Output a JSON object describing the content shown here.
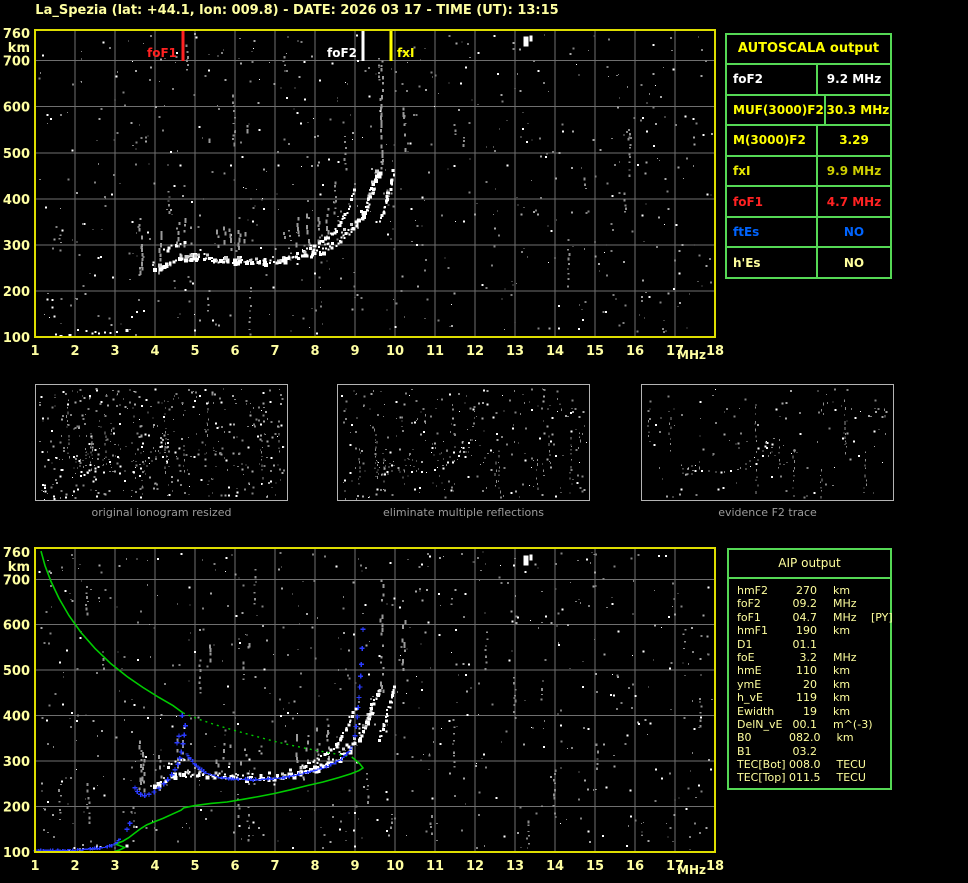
{
  "title": "La_Spezia (lat: +44.1, lon: 009.8) - DATE: 2026 03 17 - TIME (UT): 13:15",
  "autoscala": {
    "title": "AUTOSCALA output",
    "rows": [
      {
        "label": "foF2",
        "value": "9.2 MHz",
        "color": "#ffffff",
        "value_color": "#ffffff"
      },
      {
        "label": "MUF(3000)F2",
        "value": "30.3 MHz",
        "color": "#ffff00",
        "value_color": "#ffff00"
      },
      {
        "label": "M(3000)F2",
        "value": "3.29",
        "color": "#ffff00",
        "value_color": "#ffff00"
      },
      {
        "label": "fxI",
        "value": "9.9 MHz",
        "color": "#e8e800",
        "value_color": "#cfcf00"
      },
      {
        "label": "foF1",
        "value": "4.7 MHz",
        "color": "#ff2222",
        "value_color": "#ff2222"
      },
      {
        "label": "ftEs",
        "value": "NO",
        "color": "#0064ff",
        "value_color": "#0064ff"
      },
      {
        "label": "h'Es",
        "value": "NO",
        "color": "#ffff9e",
        "value_color": "#ffff9e"
      }
    ]
  },
  "aip": {
    "title": "AIP output",
    "rows": [
      {
        "label": "hmF2",
        "value": "270",
        "unit": "km",
        "extra": ""
      },
      {
        "label": "foF2",
        "value": "09.2",
        "unit": "MHz",
        "extra": ""
      },
      {
        "label": "foF1",
        "value": "04.7",
        "unit": "MHz",
        "extra": "[PY]"
      },
      {
        "label": "hmF1",
        "value": "190",
        "unit": "km",
        "extra": ""
      },
      {
        "label": "D1",
        "value": "01.1",
        "unit": "",
        "extra": ""
      },
      {
        "label": "foE",
        "value": "3.2",
        "unit": "MHz",
        "extra": ""
      },
      {
        "label": "hmE",
        "value": "110",
        "unit": "km",
        "extra": ""
      },
      {
        "label": "ymE",
        "value": "20",
        "unit": "km",
        "extra": ""
      },
      {
        "label": "h_vE",
        "value": "119",
        "unit": "km",
        "extra": ""
      },
      {
        "label": "Ewidth",
        "value": "19",
        "unit": "km",
        "extra": ""
      },
      {
        "label": "DelN_vE",
        "value": "00.1",
        "unit": "m^(-3)",
        "extra": ""
      },
      {
        "label": "B0",
        "value": "082.0",
        "unit": "km",
        "extra": ""
      },
      {
        "label": "B1",
        "value": "03.2",
        "unit": "",
        "extra": ""
      },
      {
        "label": "TEC[Bot]",
        "value": "008.0",
        "unit": "TECU",
        "extra": ""
      },
      {
        "label": "TEC[Top]",
        "value": "011.5",
        "unit": "TECU",
        "extra": ""
      }
    ]
  },
  "thumbnails": [
    {
      "label": "original ionogram resized"
    },
    {
      "label": "eliminate multiple reflections"
    },
    {
      "label": "evidence F2 trace"
    }
  ],
  "chart_data": {
    "type": "scatter",
    "colors": {
      "axis_text": "#ffffa2",
      "border": "#dede00",
      "grid": "#6f6f6f",
      "echo": "#ffffff",
      "profile_green": "#00cc00",
      "restored_blue": "#2a3bff",
      "noise_gray": "#8a8a8a"
    },
    "charts": [
      {
        "id": "autoscala-ionogram",
        "x_unit": "MHz",
        "y_unit": "km",
        "xlim": [
          1,
          18
        ],
        "ylim": [
          100,
          760
        ],
        "x_ticks": [
          1,
          2,
          3,
          4,
          5,
          6,
          7,
          8,
          9,
          10,
          11,
          12,
          13,
          14,
          15,
          16,
          17,
          18
        ],
        "y_ticks": [
          760,
          700,
          600,
          500,
          400,
          300,
          200,
          100
        ],
        "markers": [
          {
            "label": "foF1",
            "f": 4.7,
            "color": "#ff2222",
            "side": "left"
          },
          {
            "label": "foF2",
            "f": 9.2,
            "color": "#ffffff",
            "side": "left"
          },
          {
            "label": "fxI",
            "f": 9.9,
            "color": "#ffff00",
            "side": "right"
          }
        ],
        "series": [
          "noise_top",
          "streaks",
          "echo_E",
          "echo_F",
          "echo_F2x",
          "blob_top"
        ]
      },
      {
        "id": "aip-ionogram",
        "x_unit": "MHz",
        "y_unit": "km",
        "xlim": [
          1,
          18
        ],
        "ylim": [
          100,
          760
        ],
        "x_ticks": [
          1,
          2,
          3,
          4,
          5,
          6,
          7,
          8,
          9,
          10,
          11,
          12,
          13,
          14,
          15,
          16,
          17,
          18
        ],
        "y_ticks": [
          760,
          700,
          600,
          500,
          400,
          300,
          200,
          100
        ],
        "markers": [],
        "series": [
          "noise_bot",
          "streaks",
          "echo_E",
          "echo_F",
          "echo_F2x",
          "blob_top",
          "profile_topside_solid",
          "profile_topside_dotted",
          "profile_bottomside",
          "restored_flat",
          "restored_cusp",
          "restored_mid",
          "restored_asymptote"
        ]
      }
    ],
    "thumbs": [
      {
        "id": "thumb-original",
        "noise_seed": 31,
        "noise": 430,
        "series": [
          "echo_E",
          "echo_F",
          "echo_F2x",
          "streaks"
        ]
      },
      {
        "id": "thumb-eliminate",
        "noise_seed": 47,
        "noise": 250,
        "series": [
          "echo_E",
          "echo_F",
          "echo_F2x",
          "streaks"
        ]
      },
      {
        "id": "thumb-evidence",
        "noise_seed": 59,
        "noise": 115,
        "series": [
          "echo_F",
          "echo_F2x"
        ]
      }
    ],
    "series_lib": {
      "noise_top": {
        "type": "noise",
        "seed": 11,
        "count": 640,
        "columns": 23
      },
      "noise_bot": {
        "type": "noise",
        "seed": 23,
        "count": 640,
        "columns": 23
      },
      "streaks": {
        "type": "vstreaks",
        "color": "#9a9a9a",
        "items": [
          [
            3.62,
            235,
            345
          ],
          [
            3.68,
            240,
            320
          ],
          [
            4.1,
            238,
            330
          ],
          [
            4.55,
            295,
            350
          ],
          [
            4.7,
            298,
            358
          ],
          [
            4.85,
            300,
            340
          ],
          [
            5.55,
            292,
            333
          ],
          [
            5.7,
            296,
            340
          ],
          [
            5.85,
            290,
            336
          ],
          [
            6.1,
            294,
            332
          ],
          [
            6.25,
            298,
            328
          ],
          [
            7.55,
            300,
            360
          ],
          [
            7.8,
            302,
            368
          ],
          [
            8.05,
            306,
            374
          ],
          [
            8.3,
            310,
            380
          ],
          [
            9.65,
            455,
            700
          ],
          [
            10.2,
            500,
            610
          ],
          [
            5.35,
            520,
            556
          ],
          [
            6.3,
            545,
            560
          ]
        ]
      },
      "echo_E": {
        "type": "echo",
        "color": "#ffffff",
        "size": 2,
        "step": 4.5,
        "jitter": 1.2,
        "gap": 0.4,
        "points": [
          [
            1.5,
            107
          ],
          [
            2.2,
            109
          ],
          [
            2.6,
            112
          ],
          [
            3.05,
            115
          ],
          [
            3.35,
            118
          ]
        ]
      },
      "echo_F": {
        "type": "echo",
        "color": "#ffffff",
        "size": 2.4,
        "step": 2.2,
        "jitter": 2.2,
        "thick": true,
        "points": [
          [
            3.95,
            247
          ],
          [
            4.15,
            255
          ],
          [
            4.35,
            266
          ],
          [
            4.6,
            272
          ],
          [
            5.0,
            272
          ],
          [
            5.5,
            268
          ],
          [
            6.0,
            265
          ],
          [
            6.55,
            264
          ],
          [
            7.0,
            267
          ],
          [
            7.5,
            274
          ],
          [
            8.0,
            285
          ],
          [
            8.4,
            299
          ],
          [
            8.7,
            316
          ],
          [
            8.9,
            334
          ],
          [
            9.1,
            356
          ],
          [
            9.25,
            381
          ],
          [
            9.38,
            410
          ],
          [
            9.48,
            437
          ],
          [
            9.55,
            460
          ]
        ]
      },
      "echo_F2x": {
        "type": "echo",
        "color": "#ffffff",
        "size": 2,
        "step": 2.6,
        "jitter": 1.6,
        "segments": [
          [
            [
              7.7,
              292
            ],
            [
              8.05,
              306
            ],
            [
              8.35,
              324
            ],
            [
              8.6,
              347
            ],
            [
              8.78,
              374
            ],
            [
              8.9,
              402
            ],
            [
              8.97,
              425
            ]
          ],
          [
            [
              9.55,
              350
            ],
            [
              9.68,
              376
            ],
            [
              9.78,
              403
            ],
            [
              9.86,
              430
            ],
            [
              9.92,
              452
            ],
            [
              9.97,
              470
            ]
          ],
          [
            [
              4.2,
              290
            ],
            [
              4.4,
              297
            ],
            [
              4.6,
              303
            ],
            [
              4.75,
              308
            ]
          ]
        ]
      },
      "blob_top": {
        "type": "rects",
        "color": "#ffffff",
        "rects": [
          [
            13.28,
            752,
            5,
            10
          ],
          [
            13.4,
            755,
            3,
            6
          ]
        ]
      },
      "profile_bottomside": {
        "type": "line",
        "color": "#00cc00",
        "width": 1.6,
        "points": [
          [
            2.95,
            100
          ],
          [
            3.1,
            104
          ],
          [
            3.2,
            108
          ],
          [
            3.24,
            110
          ],
          [
            3.12,
            114
          ],
          [
            3.02,
            117
          ],
          [
            3.06,
            119
          ],
          [
            3.2,
            124
          ],
          [
            3.35,
            132
          ],
          [
            3.5,
            142
          ],
          [
            3.65,
            152
          ],
          [
            3.8,
            160
          ],
          [
            4.0,
            167
          ],
          [
            4.2,
            174
          ],
          [
            4.45,
            184
          ],
          [
            4.65,
            192
          ],
          [
            4.72,
            197
          ],
          [
            5.0,
            202
          ],
          [
            5.4,
            207
          ],
          [
            5.8,
            210
          ],
          [
            6.2,
            216
          ],
          [
            6.6,
            222
          ],
          [
            7.0,
            229
          ],
          [
            7.4,
            237
          ],
          [
            7.8,
            246
          ],
          [
            8.2,
            254
          ],
          [
            8.6,
            264
          ],
          [
            8.9,
            272
          ],
          [
            9.1,
            279
          ],
          [
            9.2,
            285
          ],
          [
            9.12,
            294
          ],
          [
            9.0,
            303
          ],
          [
            8.92,
            309
          ]
        ]
      },
      "profile_topside_solid": {
        "type": "line",
        "color": "#00cc00",
        "width": 1.6,
        "points": [
          [
            1.15,
            762
          ],
          [
            1.25,
            730
          ],
          [
            1.4,
            695
          ],
          [
            1.6,
            658
          ],
          [
            1.85,
            620
          ],
          [
            2.15,
            583
          ],
          [
            2.5,
            548
          ],
          [
            2.9,
            514
          ],
          [
            3.3,
            486
          ],
          [
            3.7,
            462
          ],
          [
            4.1,
            440
          ],
          [
            4.45,
            422
          ],
          [
            4.7,
            406
          ]
        ]
      },
      "profile_topside_dotted": {
        "type": "line",
        "color": "#00cc00",
        "width": 1.4,
        "dash": "2 4",
        "points": [
          [
            4.7,
            406
          ],
          [
            5.1,
            392
          ],
          [
            5.5,
            380
          ],
          [
            6.0,
            367
          ],
          [
            6.5,
            355
          ],
          [
            7.0,
            343
          ],
          [
            7.5,
            333
          ],
          [
            8.0,
            324
          ],
          [
            8.5,
            316
          ],
          [
            8.9,
            309
          ]
        ]
      },
      "restored_flat": {
        "type": "plus-dense",
        "color": "#2a3bff",
        "step": 2.4,
        "points": [
          [
            1.0,
            104
          ],
          [
            1.8,
            105
          ],
          [
            2.3,
            107
          ],
          [
            2.6,
            110
          ],
          [
            2.85,
            114
          ],
          [
            3.0,
            119
          ],
          [
            3.08,
            126
          ],
          [
            3.14,
            132
          ]
        ]
      },
      "restored_cusp": {
        "type": "plus",
        "color": "#2a3bff",
        "points": [
          [
            3.3,
            150
          ],
          [
            3.37,
            163
          ],
          [
            3.5,
            241
          ],
          [
            3.56,
            233
          ],
          [
            3.64,
            227
          ],
          [
            3.74,
            224
          ],
          [
            3.85,
            227
          ],
          [
            3.98,
            232
          ],
          [
            4.1,
            240
          ],
          [
            4.22,
            250
          ],
          [
            4.32,
            259
          ],
          [
            4.42,
            270
          ],
          [
            4.5,
            281
          ],
          [
            4.57,
            293
          ],
          [
            4.62,
            306
          ],
          [
            4.66,
            320
          ],
          [
            4.7,
            338
          ],
          [
            4.73,
            357
          ],
          [
            4.76,
            378
          ],
          [
            4.6,
            355
          ],
          [
            4.55,
            340
          ],
          [
            4.68,
            400
          ]
        ]
      },
      "restored_mid": {
        "type": "plus-dense",
        "color": "#2a3bff",
        "step": 2.4,
        "points": [
          [
            4.8,
            318
          ],
          [
            4.88,
            306
          ],
          [
            4.97,
            296
          ],
          [
            5.1,
            285
          ],
          [
            5.3,
            274
          ],
          [
            5.6,
            266
          ],
          [
            6.0,
            262
          ],
          [
            6.5,
            260
          ],
          [
            7.0,
            263
          ],
          [
            7.4,
            268
          ],
          [
            7.8,
            276
          ],
          [
            8.2,
            286
          ],
          [
            8.5,
            297
          ],
          [
            8.7,
            309
          ],
          [
            8.85,
            322
          ],
          [
            8.95,
            337
          ]
        ]
      },
      "restored_asymptote": {
        "type": "plus",
        "color": "#2a3bff",
        "points": [
          [
            9.0,
            356
          ],
          [
            9.03,
            376
          ],
          [
            9.06,
            397
          ],
          [
            9.08,
            418
          ],
          [
            9.1,
            440
          ],
          [
            9.12,
            463
          ],
          [
            9.14,
            487
          ],
          [
            9.16,
            513
          ],
          [
            9.18,
            548
          ],
          [
            9.2,
            590
          ]
        ]
      }
    }
  }
}
